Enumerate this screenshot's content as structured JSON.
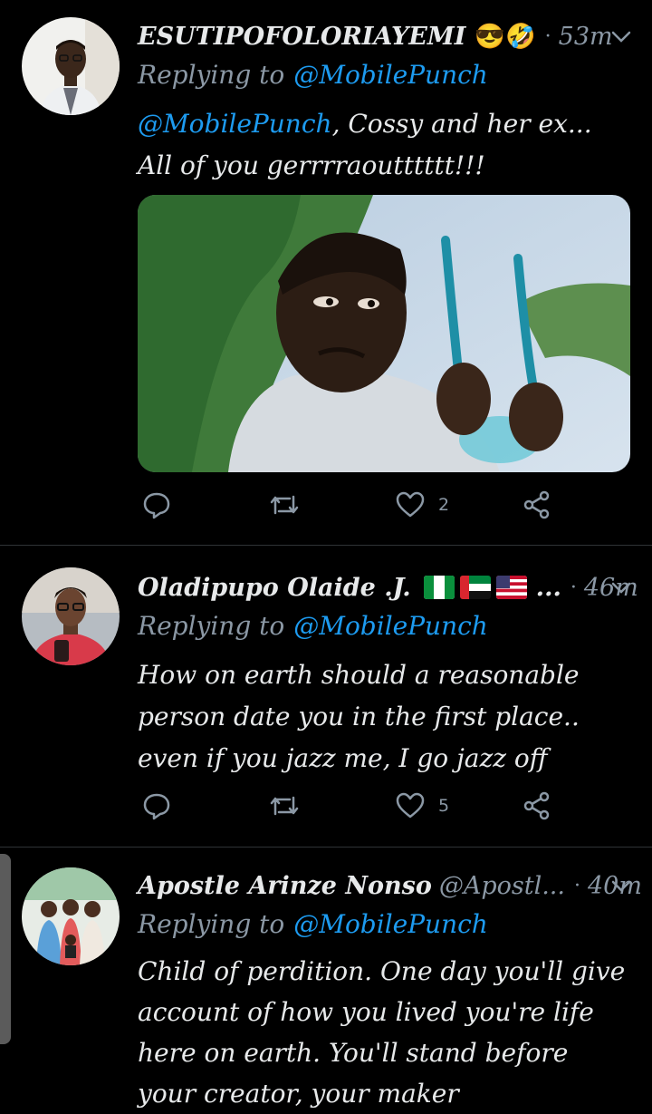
{
  "tweets": [
    {
      "name": "ESUTIPOFOLORIAYEMI",
      "emoji": "😎🤣",
      "time": "53m",
      "replying_label": "Replying to",
      "replying_handle": "@MobilePunch",
      "body_mention": "@MobilePunch",
      "body_text": ", Cossy and her ex... All of you gerrrraoutttttt!!!",
      "likes": "2"
    },
    {
      "name": "Oladipupo Olaide .J.",
      "flags": [
        "nigeria-flag",
        "uae-flag",
        "usa-flag"
      ],
      "truncated": "...",
      "time": "46m",
      "replying_label": "Replying to",
      "replying_handle": "@MobilePunch",
      "body_text": "How on earth should a reasonable person date you in the first place.. even if you jazz me, I go jazz off",
      "likes": "5"
    },
    {
      "name": "Apostle Arinze Nonso",
      "handle": "@Apostl...",
      "time": "40m",
      "replying_label": "Replying to",
      "replying_handle": "@MobilePunch",
      "body_text": "Child of perdition. One day you'll give account of how you lived you're life here on earth. You'll stand before your creator, your maker"
    }
  ],
  "separator": "·",
  "colors": {
    "accent": "#1d9bf0",
    "muted": "#8b98a5",
    "background": "#000000"
  },
  "icons": [
    "reply-icon",
    "retweet-icon",
    "like-icon",
    "share-icon",
    "chevron-down-icon"
  ]
}
